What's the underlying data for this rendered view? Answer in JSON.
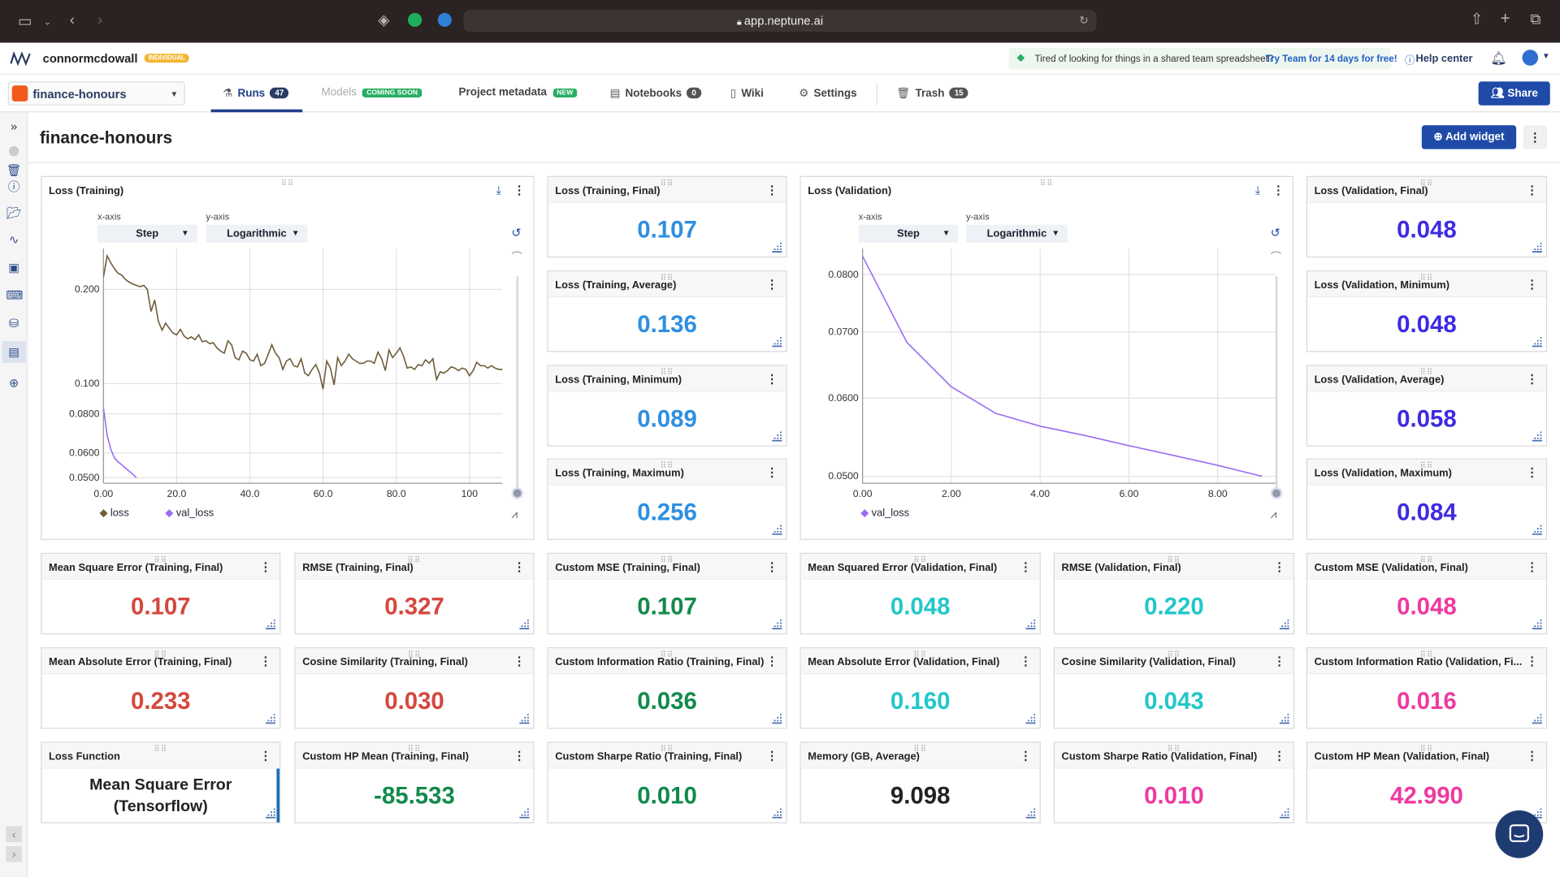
{
  "browser": {
    "url": "app.neptune.ai"
  },
  "header": {
    "workspace": "connormcdowall",
    "workspace_badge": "INDIVIDUAL",
    "promo_text": "Tired of looking for things in a shared team spreadsheet?",
    "promo_link": "Try Team for 14 days for free!",
    "help": "Help center"
  },
  "project": {
    "name": "finance-honours"
  },
  "tabs": {
    "runs": "Runs",
    "runs_count": "47",
    "models": "Models",
    "models_badge": "COMING SOON",
    "metadata": "Project metadata",
    "metadata_badge": "NEW",
    "notebooks": "Notebooks",
    "notebooks_count": "0",
    "wiki": "Wiki",
    "settings": "Settings",
    "trash": "Trash",
    "trash_count": "15",
    "share": "Share"
  },
  "page": {
    "title": "finance-honours",
    "add_widget": "Add widget"
  },
  "charts": {
    "train": {
      "title": "Loss (Training)",
      "xaxis_label": "x-axis",
      "yaxis_label": "y-axis",
      "xaxis_value": "Step",
      "yaxis_value": "Logarithmic",
      "legend_loss": "loss",
      "legend_val": "val_loss"
    },
    "val": {
      "title": "Loss (Validation)",
      "xaxis_label": "x-axis",
      "yaxis_label": "y-axis",
      "xaxis_value": "Step",
      "yaxis_value": "Logarithmic",
      "legend_val": "val_loss"
    }
  },
  "chart_data": [
    {
      "type": "line",
      "title": "Loss (Training)",
      "y_scale": "log",
      "xlim": [
        0,
        109
      ],
      "ylim": [
        0.048,
        0.27
      ],
      "x_ticks": [
        "0.00",
        "20.0",
        "40.0",
        "60.0",
        "80.0",
        "100"
      ],
      "y_ticks": [
        "0.200",
        "0.100",
        "0.0800",
        "0.0600",
        "0.0500"
      ],
      "legend": "bottom",
      "series": [
        {
          "name": "loss",
          "color": "#6f5c3a",
          "x": [
            0,
            1,
            2,
            3,
            4,
            5,
            6,
            7,
            8,
            9,
            10,
            11,
            12,
            13,
            14,
            15,
            16,
            17,
            18,
            19,
            20,
            21,
            22,
            23,
            24,
            25,
            26,
            27,
            28,
            29,
            30,
            31,
            32,
            33,
            34,
            35,
            36,
            37,
            38,
            39,
            40,
            41,
            42,
            43,
            44,
            45,
            46,
            47,
            48,
            49,
            50,
            51,
            52,
            53,
            54,
            55,
            56,
            57,
            58,
            59,
            60,
            61,
            62,
            63,
            64,
            65,
            66,
            67,
            68,
            69,
            70,
            71,
            72,
            73,
            74,
            75,
            76,
            77,
            78,
            79,
            80,
            81,
            82,
            83,
            84,
            85,
            86,
            87,
            88,
            89,
            90,
            91,
            92,
            93,
            94,
            95,
            96,
            97,
            98,
            99,
            100,
            101,
            102,
            103,
            104,
            105,
            106,
            107,
            108,
            109
          ],
          "y": [
            0.219,
            0.256,
            0.243,
            0.233,
            0.225,
            0.222,
            0.215,
            0.211,
            0.208,
            0.206,
            0.204,
            0.206,
            0.2,
            0.17,
            0.185,
            0.158,
            0.148,
            0.156,
            0.15,
            0.145,
            0.143,
            0.149,
            0.142,
            0.139,
            0.141,
            0.138,
            0.143,
            0.136,
            0.137,
            0.134,
            0.135,
            0.13,
            0.127,
            0.125,
            0.137,
            0.133,
            0.121,
            0.119,
            0.127,
            0.125,
            0.119,
            0.118,
            0.124,
            0.114,
            0.116,
            0.124,
            0.133,
            0.125,
            0.121,
            0.111,
            0.118,
            0.12,
            0.114,
            0.113,
            0.12,
            0.108,
            0.106,
            0.111,
            0.115,
            0.108,
            0.096,
            0.118,
            0.112,
            0.099,
            0.121,
            0.114,
            0.118,
            0.124,
            0.12,
            0.118,
            0.116,
            0.116,
            0.118,
            0.118,
            0.116,
            0.126,
            0.12,
            0.11,
            0.128,
            0.121,
            0.125,
            0.13,
            0.122,
            0.112,
            0.113,
            0.111,
            0.115,
            0.114,
            0.119,
            0.116,
            0.12,
            0.103,
            0.109,
            0.108,
            0.11,
            0.113,
            0.112,
            0.11,
            0.112,
            0.111,
            0.106,
            0.11,
            0.117,
            0.114,
            0.114,
            0.112,
            0.114,
            0.112,
            0.111,
            0.111
          ]
        },
        {
          "name": "val_loss",
          "color": "#9b6cf2",
          "x": [
            0,
            1,
            2,
            3,
            4,
            5,
            6,
            7,
            8,
            9
          ],
          "y": [
            0.0835,
            0.0683,
            0.0616,
            0.0579,
            0.0562,
            0.055,
            0.0537,
            0.0525,
            0.0513,
            0.05
          ]
        }
      ]
    },
    {
      "type": "line",
      "title": "Loss (Validation)",
      "y_scale": "log",
      "xlim": [
        0,
        9.3
      ],
      "ylim": [
        0.0492,
        0.085
      ],
      "x_ticks": [
        "0.00",
        "2.00",
        "4.00",
        "6.00",
        "8.00"
      ],
      "y_ticks": [
        "0.0800",
        "0.0700",
        "0.0600",
        "0.0500"
      ],
      "legend": "bottom",
      "series": [
        {
          "name": "val_loss",
          "color": "#9b6cf2",
          "x": [
            0,
            1,
            2,
            3,
            4,
            5,
            6,
            7,
            8,
            9
          ],
          "y": [
            0.0835,
            0.0683,
            0.0616,
            0.0579,
            0.0562,
            0.055,
            0.0537,
            0.0525,
            0.0513,
            0.05
          ]
        }
      ]
    }
  ],
  "widgets": {
    "tf": {
      "title": "Loss (Training, Final)",
      "value": "0.107",
      "color": "#2f8fe0"
    },
    "ta": {
      "title": "Loss (Training, Average)",
      "value": "0.136",
      "color": "#2f8fe0"
    },
    "tmin": {
      "title": "Loss (Training, Minimum)",
      "value": "0.089",
      "color": "#2f8fe0"
    },
    "tmax": {
      "title": "Loss (Training, Maximum)",
      "value": "0.256",
      "color": "#2f8fe0"
    },
    "vf": {
      "title": "Loss (Validation, Final)",
      "value": "0.048",
      "color": "#3e2be0"
    },
    "vmin": {
      "title": "Loss (Validation, Minimum)",
      "value": "0.048",
      "color": "#3e2be0"
    },
    "va": {
      "title": "Loss (Validation, Average)",
      "value": "0.058",
      "color": "#3e2be0"
    },
    "vmax": {
      "title": "Loss (Validation, Maximum)",
      "value": "0.084",
      "color": "#3e2be0"
    },
    "r1": [
      {
        "title": "Mean Square Error (Training, Final)",
        "value": "0.107",
        "color": "#d4483e"
      },
      {
        "title": "RMSE (Training, Final)",
        "value": "0.327",
        "color": "#d4483e"
      },
      {
        "title": "Custom MSE (Training, Final)",
        "value": "0.107",
        "color": "#128a4c"
      },
      {
        "title": "Mean Squared Error (Validation, Final)",
        "value": "0.048",
        "color": "#22c7c9"
      },
      {
        "title": "RMSE (Validation, Final)",
        "value": "0.220",
        "color": "#22c7c9"
      },
      {
        "title": "Custom MSE (Validation, Final)",
        "value": "0.048",
        "color": "#ee3aa0"
      }
    ],
    "r2": [
      {
        "title": "Mean Absolute Error (Training, Final)",
        "value": "0.233",
        "color": "#d4483e"
      },
      {
        "title": "Cosine Similarity (Training, Final)",
        "value": "0.030",
        "color": "#d4483e"
      },
      {
        "title": "Custom Information Ratio (Training, Final)",
        "value": "0.036",
        "color": "#128a4c"
      },
      {
        "title": "Mean Absolute Error (Validation, Final)",
        "value": "0.160",
        "color": "#22c7c9"
      },
      {
        "title": "Cosine Similarity (Validation, Final)",
        "value": "0.043",
        "color": "#22c7c9"
      },
      {
        "title": "Custom Information Ratio (Validation, Fi...",
        "value": "0.016",
        "color": "#ee3aa0"
      }
    ],
    "r3": [
      {
        "title": "Loss Function",
        "value": "",
        "color": "#222"
      },
      {
        "title": "Custom HP Mean (Training, Final)",
        "value": "-85.533",
        "color": "#128a4c"
      },
      {
        "title": "Custom Sharpe Ratio (Training, Final)",
        "value": "0.010",
        "color": "#128a4c"
      },
      {
        "title": "Memory (GB, Average)",
        "value": "9.098",
        "color": "#222"
      },
      {
        "title": "Custom Sharpe Ratio (Validation, Final)",
        "value": "0.010",
        "color": "#ee3aa0"
      },
      {
        "title": "Custom HP Mean (Validation, Final)",
        "value": "42.990",
        "color": "#ee3aa0"
      }
    ],
    "loss_fn_line1": "Mean Square Error",
    "loss_fn_line2": "(Tensorflow)"
  }
}
